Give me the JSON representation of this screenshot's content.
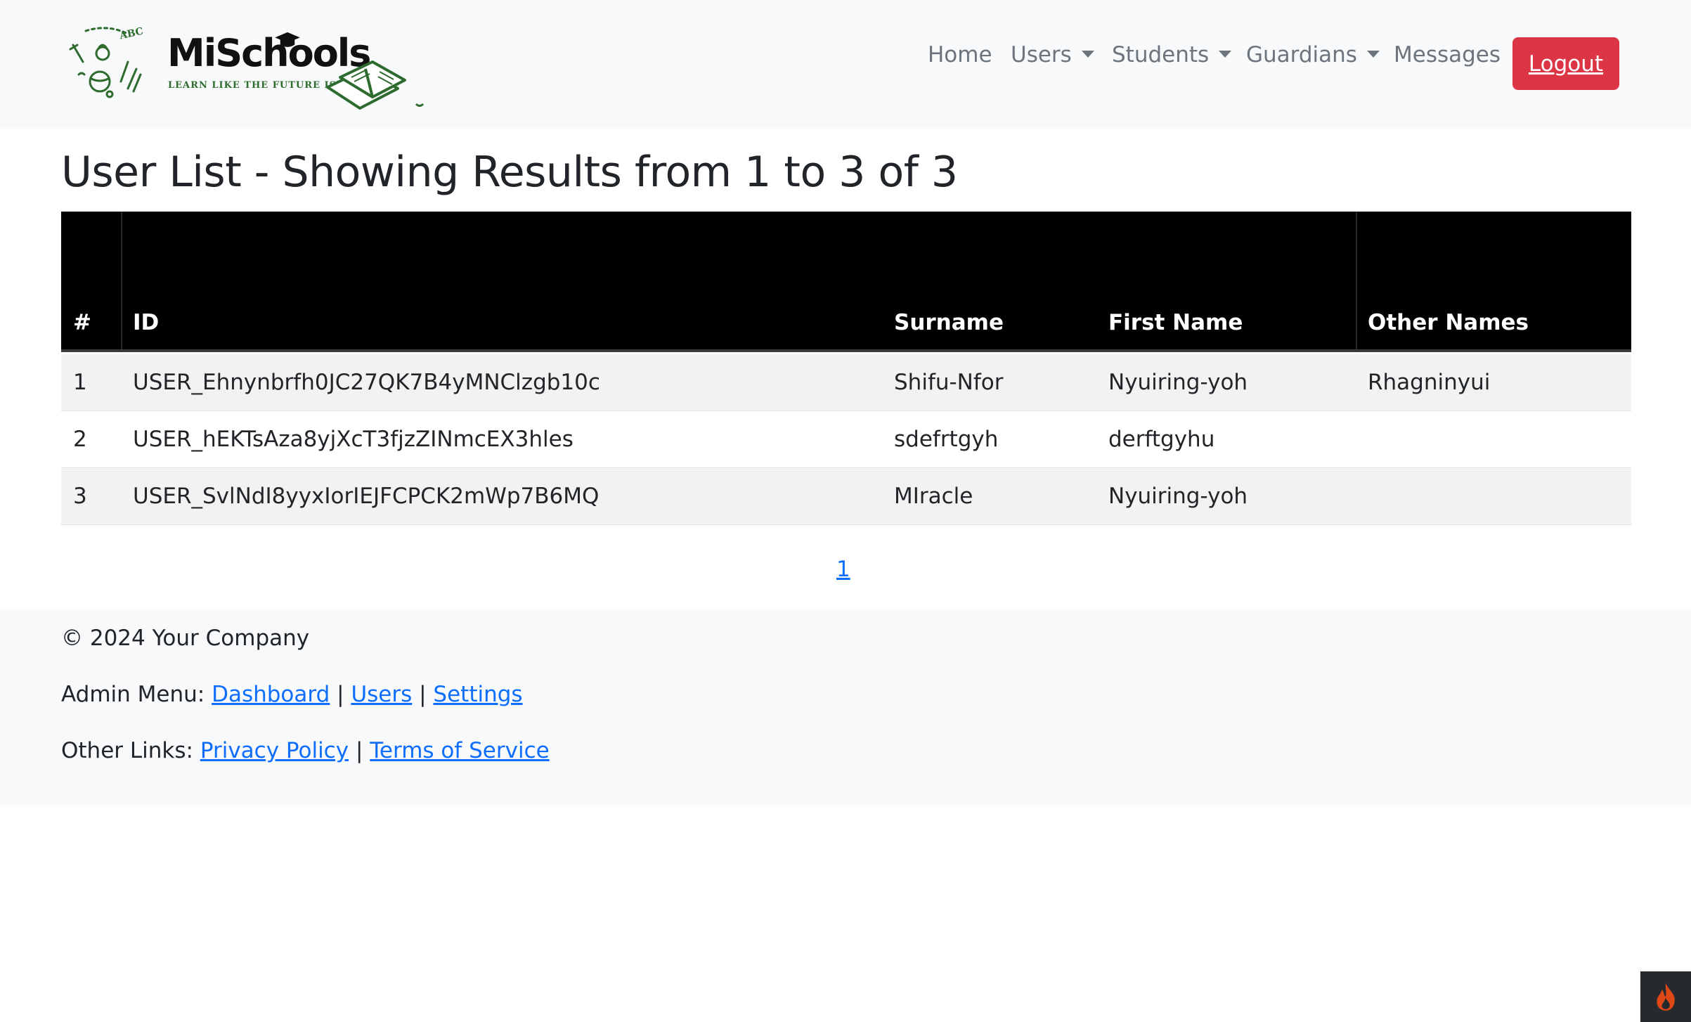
{
  "brand": {
    "name": "MiSchools",
    "tagline": "LEARN LIKE THE FUTURE IS NOW",
    "doodle_text": "ABC",
    "accent_color": "#2e6b2e"
  },
  "nav": {
    "items": [
      {
        "label": "Home",
        "has_dropdown": false
      },
      {
        "label": "Users",
        "has_dropdown": true
      },
      {
        "label": "Students",
        "has_dropdown": true
      },
      {
        "label": "Guardians",
        "has_dropdown": true
      },
      {
        "label": "Messages",
        "has_dropdown": false
      }
    ],
    "logout_label": "Logout",
    "logout_color": "#dc3545"
  },
  "page": {
    "title": "User List - Showing Results from 1 to 3 of 3"
  },
  "table": {
    "headers": [
      "#",
      "ID",
      "Surname",
      "First Name",
      "Other Names"
    ],
    "rows": [
      [
        "1",
        "USER_Ehnynbrfh0JC27QK7B4yMNClzgb10c",
        "Shifu-Nfor",
        "Nyuiring-yoh",
        "Rhagninyui"
      ],
      [
        "2",
        "USER_hEKTsAza8yjXcT3fjzZINmcEX3hles",
        "sdefrtgyh",
        "derftgyhu",
        ""
      ],
      [
        "3",
        "USER_SvlNdI8yyxIorIEJFCPCK2mWp7B6MQ",
        "MIracle",
        "Nyuiring-yoh",
        ""
      ]
    ]
  },
  "pagination": {
    "pages": [
      "1"
    ]
  },
  "footer": {
    "copyright": "© 2024 Your Company",
    "admin_menu_label": "Admin Menu:",
    "admin_links": [
      "Dashboard",
      "Users",
      "Settings"
    ],
    "other_links_label": "Other Links:",
    "other_links": [
      "Privacy Policy",
      "Terms of Service"
    ],
    "separator": "|"
  },
  "debug_toolbar": {
    "icon": "flame-icon"
  }
}
